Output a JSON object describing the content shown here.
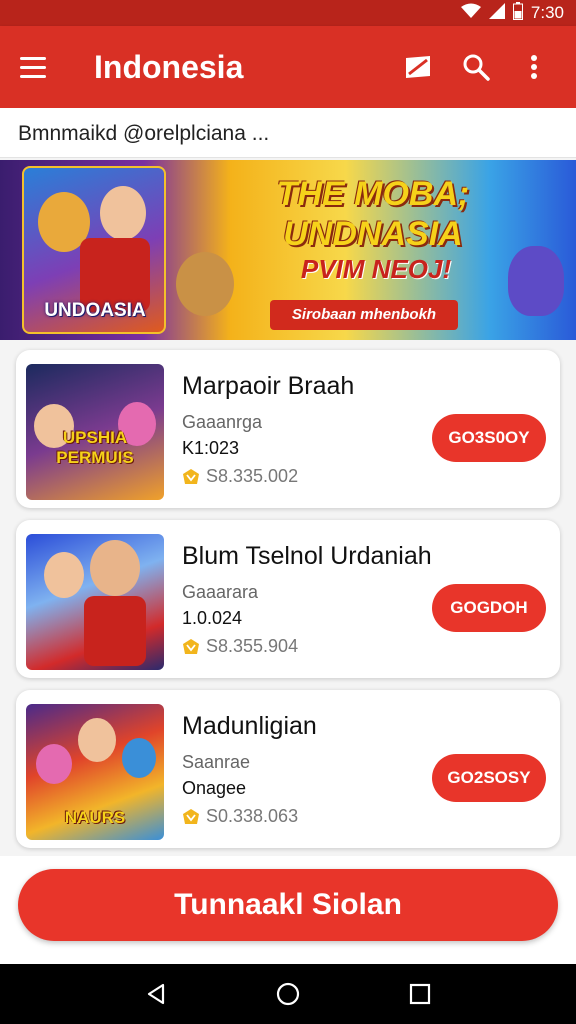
{
  "status_bar": {
    "time": "7:30"
  },
  "app_bar": {
    "title": "Indonesia",
    "icons": [
      "menu-icon",
      "flag-icon",
      "search-icon",
      "more-vert-icon"
    ]
  },
  "subtitle": "Bmnmaikd  @orelplciana ...",
  "banner": {
    "art_label": "UNDOASIA",
    "headline": "THE MOBA; UNDNASIA",
    "subheadline": "PVIM NEOJ!",
    "ribbon": "Sirobaan mhenbokh"
  },
  "games": [
    {
      "title": "Marpaoir Braah",
      "genre": "Gaaanrga",
      "meta": "K1:023",
      "price": "S8.335.002",
      "button": "GO3S0OY",
      "thumb_label": "UPSHIA PERMUIS"
    },
    {
      "title": "Blum Tselnol Urdaniah",
      "genre": "Gaaarara",
      "meta": "1.0.024",
      "price": "S8.355.904",
      "button": "GOGDOH",
      "thumb_label": ""
    },
    {
      "title": "Madunligian",
      "genre": "Saanrae",
      "meta": "Onagee",
      "price": "S0.338.063",
      "button": "GO2SOSY",
      "thumb_label": "NAURS"
    }
  ],
  "cta": {
    "label": "Tunnaakl Siolan"
  },
  "nav": {
    "icons": [
      "back-icon",
      "home-icon",
      "recents-icon"
    ]
  },
  "colors": {
    "primary": "#d93025",
    "status_bar": "#b8241b",
    "button": "#e8352a",
    "coin": "#f2b51c"
  }
}
